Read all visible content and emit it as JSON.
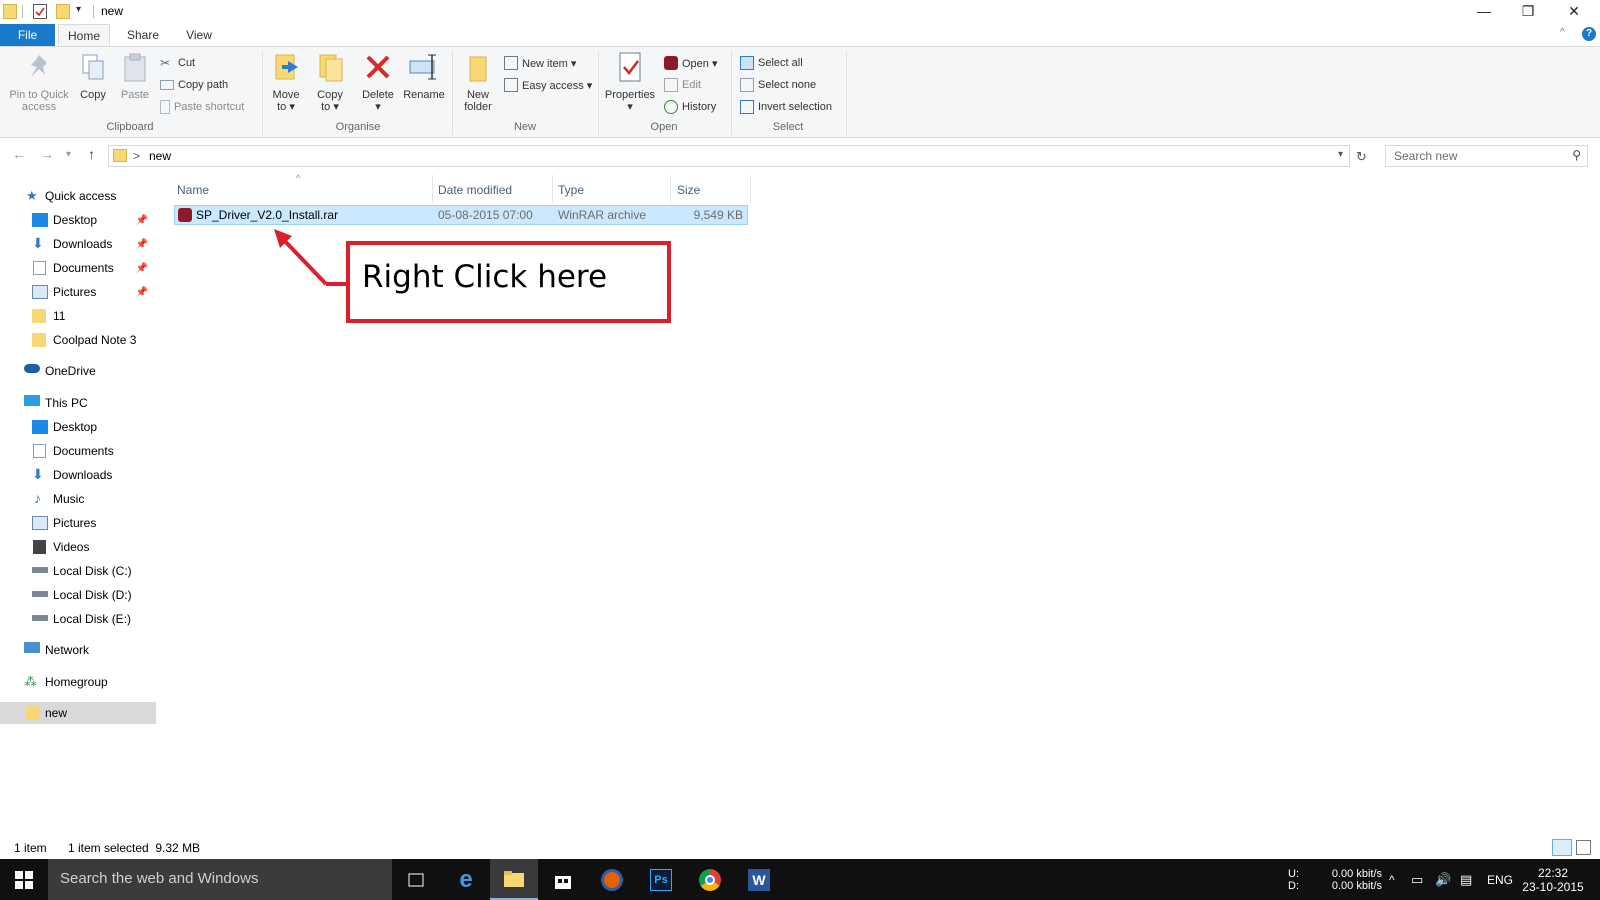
{
  "window": {
    "title": "new",
    "controls": {
      "minimize": "—",
      "restore": "❐",
      "close": "✕"
    }
  },
  "tabs": [
    {
      "label": "File"
    },
    {
      "label": "Home"
    },
    {
      "label": "Share"
    },
    {
      "label": "View"
    }
  ],
  "ribbon": {
    "clipboard": {
      "label": "Clipboard",
      "pin_label_1": "Pin to Quick",
      "pin_label_2": "access",
      "copy": "Copy",
      "paste": "Paste",
      "cut": "Cut",
      "copy_path": "Copy path",
      "paste_shortcut": "Paste shortcut"
    },
    "organise": {
      "label": "Organise",
      "move_1": "Move",
      "move_2": "to ▾",
      "copy_1": "Copy",
      "copy_2": "to ▾",
      "delete_1": "Delete",
      "delete_2": "▾",
      "rename": "Rename"
    },
    "new": {
      "label": "New",
      "new_folder_1": "New",
      "new_folder_2": "folder",
      "new_item": "New item ▾",
      "easy_access": "Easy access ▾"
    },
    "open": {
      "label": "Open",
      "properties_1": "Properties",
      "properties_2": "▾",
      "open": "Open ▾",
      "edit": "Edit",
      "history": "History"
    },
    "select": {
      "label": "Select",
      "select_all": "Select all",
      "select_none": "Select none",
      "invert": "Invert selection"
    }
  },
  "address": {
    "path": "new",
    "separator": ">",
    "search_placeholder": "Search new"
  },
  "navpane": {
    "quick_access": "Quick access",
    "quick_items": [
      "Desktop",
      "Downloads",
      "Documents",
      "Pictures",
      "11",
      "Coolpad Note 3"
    ],
    "onedrive": "OneDrive",
    "this_pc": "This PC",
    "pc_items": [
      "Desktop",
      "Documents",
      "Downloads",
      "Music",
      "Pictures",
      "Videos",
      "Local Disk (C:)",
      "Local Disk (D:)",
      "Local Disk (E:)"
    ],
    "network": "Network",
    "homegroup": "Homegroup",
    "selected": "new"
  },
  "filelist": {
    "columns": [
      "Name",
      "Date modified",
      "Type",
      "Size"
    ],
    "rows": [
      {
        "name": "SP_Driver_V2.0_Install.rar",
        "date": "05-08-2015 07:00",
        "type": "WinRAR archive",
        "size": "9,549 KB"
      }
    ]
  },
  "annotation": {
    "text": "Right Click here",
    "color": "#d9202c"
  },
  "status": {
    "count": "1 item",
    "selection": "1 item selected  9.32 MB"
  },
  "taskbar": {
    "search_placeholder": "Search the web and Windows",
    "net_u_label": "U:",
    "net_d_label": "D:",
    "net_u": "0.00 kbit/s",
    "net_d": "0.00 kbit/s",
    "lang": "ENG",
    "time": "22:32",
    "date": "23-10-2015"
  },
  "colors": {
    "accent": "#1979ca",
    "selection_bg": "#cce8ff",
    "folder": "#f8d775"
  }
}
